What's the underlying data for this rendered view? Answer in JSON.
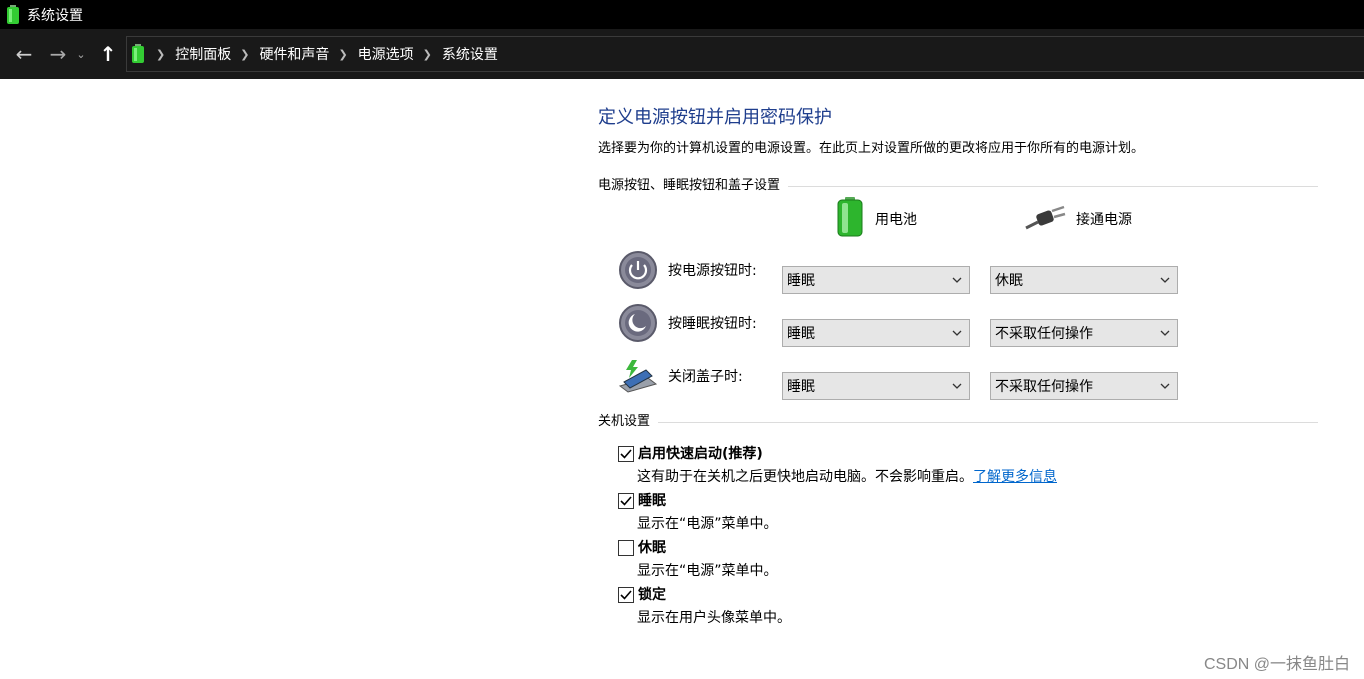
{
  "window": {
    "title": "系统设置"
  },
  "address": {
    "breadcrumbs": [
      "控制面板",
      "硬件和声音",
      "电源选项",
      "系统设置"
    ]
  },
  "page": {
    "heading": "定义电源按钮并启用密码保护",
    "description": "选择要为你的计算机设置的电源设置。在此页上对设置所做的更改将应用于你所有的电源计划。",
    "buttons_section": {
      "title": "电源按钮、睡眠按钮和盖子设置",
      "col_battery": "用电池",
      "col_plugged": "接通电源",
      "rows": [
        {
          "label": "按电源按钮时:",
          "battery": "睡眠",
          "plugged": "休眠"
        },
        {
          "label": "按睡眠按钮时:",
          "battery": "睡眠",
          "plugged": "不采取任何操作"
        },
        {
          "label": "关闭盖子时:",
          "battery": "睡眠",
          "plugged": "不采取任何操作"
        }
      ]
    },
    "shutdown_section": {
      "title": "关机设置",
      "items": [
        {
          "label": "启用快速启动(推荐)",
          "desc": "这有助于在关机之后更快地启动电脑。不会影响重启。",
          "link": "了解更多信息",
          "checked": true
        },
        {
          "label": "睡眠",
          "desc": "显示在“电源”菜单中。",
          "checked": true
        },
        {
          "label": "休眠",
          "desc": "显示在“电源”菜单中。",
          "checked": false
        },
        {
          "label": "锁定",
          "desc": "显示在用户头像菜单中。",
          "checked": true
        }
      ]
    }
  },
  "watermark": "CSDN @一抹鱼肚白"
}
